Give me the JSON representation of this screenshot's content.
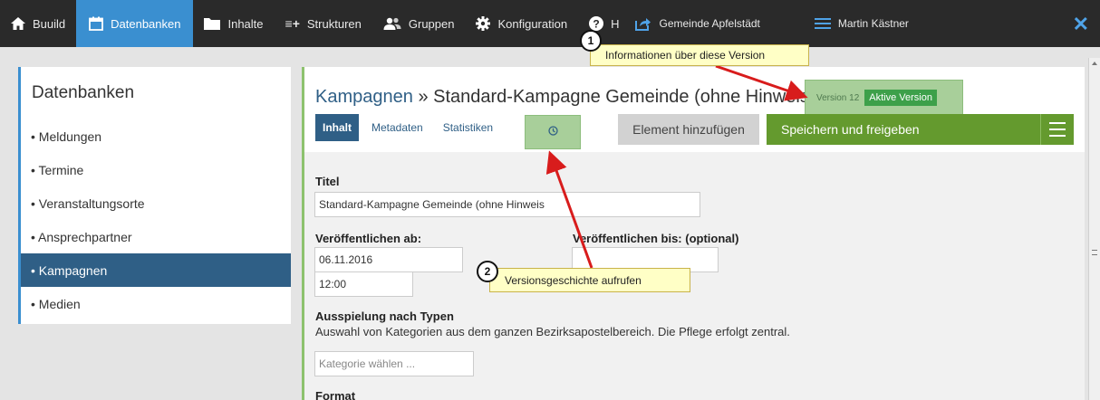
{
  "nav": {
    "items": [
      {
        "label": "Buuild",
        "icon": "home-icon"
      },
      {
        "label": "Datenbanken",
        "icon": "calendar-icon",
        "active": true
      },
      {
        "label": "Inhalte",
        "icon": "folder-icon"
      },
      {
        "label": "Strukturen",
        "icon": "structure-icon",
        "glyph": "≡+"
      },
      {
        "label": "Gruppen",
        "icon": "users-icon"
      },
      {
        "label": "Konfiguration",
        "icon": "gear-icon"
      },
      {
        "label": "H",
        "icon": "help-icon"
      },
      {
        "label": "Gemeinde Apfelstädt",
        "icon": "share-icon"
      },
      {
        "label": "Martin Kästner",
        "icon": "menu-icon"
      }
    ],
    "close_glyph": "✕"
  },
  "sidebar": {
    "title": "Datenbanken",
    "items": [
      {
        "label": "• Meldungen"
      },
      {
        "label": "• Termine"
      },
      {
        "label": "• Veranstaltungsorte"
      },
      {
        "label": "• Ansprechpartner"
      },
      {
        "label": "• Kampagnen",
        "active": true
      },
      {
        "label": "• Medien"
      }
    ]
  },
  "main": {
    "breadcrumb": "Kampagnen",
    "separator": "»",
    "title": "Standard-Kampagne Gemeinde (ohne Hinweis)",
    "version_label": "Version 12",
    "active_badge": "Aktive Version",
    "tabs": [
      "Inhalt",
      "Metadaten",
      "Statistiken"
    ],
    "history_icon": "clock-icon",
    "add_button": "Element hinzufügen",
    "save_button": "Speichern und freigeben",
    "menu_icon": "hamburger-icon"
  },
  "form": {
    "title_label": "Titel",
    "title_value": "Standard-Kampagne Gemeinde (ohne Hinweis",
    "publish_from_label": "Veröffentlichen ab:",
    "publish_from_date": "06.11.2016",
    "publish_from_time": "12:00",
    "publish_until_label": "Veröffentlichen bis: (optional)",
    "types_label": "Ausspielung nach Typen",
    "types_help": "Auswahl von Kategorien aus dem ganzen Bezirksapostelbereich. Die Pflege erfolgt zentral.",
    "category_placeholder": "Kategorie wählen ...",
    "format_label": "Format"
  },
  "callouts": [
    {
      "number": "1",
      "text": "Informationen über diese Version"
    },
    {
      "number": "2",
      "text": "Versionsgeschichte aufrufen"
    }
  ],
  "colors": {
    "nav_bg": "#2a2a2a",
    "nav_active": "#3a8fd0",
    "sidebar_active": "#2f5f86",
    "save_green": "#649a2e",
    "highlight_green": "#a8cf9a",
    "arrow_red": "#d81c1c",
    "callout_yellow": "#ffffc6"
  }
}
